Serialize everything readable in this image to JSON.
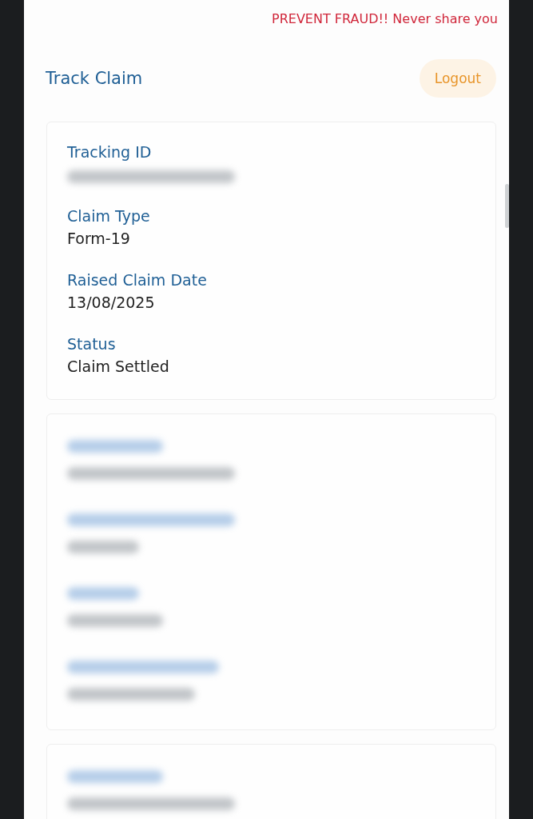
{
  "banner": {
    "text": "PREVENT FRAUD!! Never share you"
  },
  "header": {
    "title": "Track Claim",
    "logout": "Logout"
  },
  "cards": [
    {
      "kind": "detail",
      "fields": [
        {
          "label": "Tracking ID",
          "redacted": true
        },
        {
          "label": "Claim Type",
          "value": "Form-19",
          "redacted": false
        },
        {
          "label": "Raised Claim Date",
          "value": "13/08/2025",
          "redacted": false
        },
        {
          "label": "Status",
          "value": "Claim Settled",
          "redacted": false
        }
      ]
    },
    {
      "kind": "redacted",
      "rows": [
        {
          "kind": "redacted"
        },
        {
          "kind": "redacted"
        },
        {
          "kind": "redacted"
        },
        {
          "kind": "redacted"
        }
      ]
    },
    {
      "kind": "redacted",
      "rows": [
        {
          "kind": "redacted"
        }
      ]
    }
  ]
}
